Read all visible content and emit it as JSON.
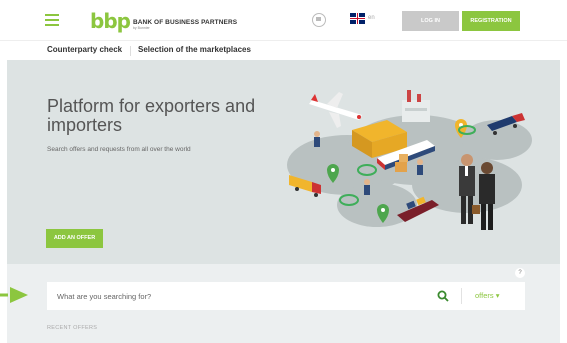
{
  "header": {
    "logo_mark": "bbp",
    "logo_name": "BANK OF BUSINESS PARTNERS",
    "logo_sub": "by Bonnier",
    "language": "en",
    "login_label": "LOG IN",
    "register_label": "REGISTRATION"
  },
  "subnav": {
    "items": [
      "Counterparty check",
      "Selection of the marketplaces"
    ]
  },
  "hero": {
    "title": "Platform for exporters and importers",
    "subtitle": "Search offers and requests from all over the world",
    "add_offer_label": "ADD AN OFFER"
  },
  "search": {
    "placeholder": "What are you searching for?",
    "scope_selected": "offers ▾",
    "help": "?",
    "recent_label": "RECENT OFFERS"
  },
  "colors": {
    "brand_green": "#8cc63f",
    "hero_bg": "#dde3e3",
    "login_gray": "#c9c9c9"
  },
  "icons": [
    "hamburger-icon",
    "chat-icon",
    "uk-flag-icon",
    "search-icon",
    "help-icon",
    "arrow-right-icon"
  ]
}
